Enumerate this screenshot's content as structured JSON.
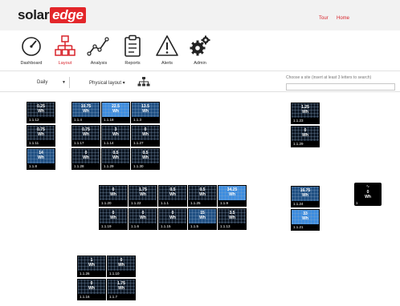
{
  "header": {
    "logo": {
      "solar": "solar",
      "edge": "edge"
    },
    "tour": "Tour",
    "home": "Home"
  },
  "nav": [
    {
      "label": "Dashboard",
      "icon": "dashboard-gauge-icon"
    },
    {
      "label": "Layout",
      "icon": "layout-sitemap-icon",
      "active": true
    },
    {
      "label": "Analysis",
      "icon": "analysis-line-chart-icon"
    },
    {
      "label": "Reports",
      "icon": "reports-clipboard-icon"
    },
    {
      "label": "Alerts",
      "icon": "alerts-warning-icon"
    },
    {
      "label": "Admin",
      "icon": "admin-gears-icon"
    }
  ],
  "site": {
    "choose": "Choose a site (insert at least 3 letters to search)",
    "value": ""
  },
  "toolbar": {
    "period": "Daily",
    "layout": "Physical layout ▾"
  },
  "colors": {
    "brand_red": "#d8232a",
    "tile_dark": "#0d1622",
    "tile_mid": "#1f4f82",
    "tile_bright": "#3d8de0"
  },
  "groups": [
    {
      "name": "group-a",
      "tiles": [
        {
          "value": "0.25",
          "unit": "Wh",
          "id": "1.1.12",
          "level": "dark"
        },
        {
          "value": "10.75",
          "unit": "Wh",
          "id": "1.1.4",
          "level": "mid"
        },
        {
          "value": "22.5",
          "unit": "Wh",
          "id": "1.1.18",
          "level": "bright"
        },
        {
          "value": "13.5",
          "unit": "Wh",
          "id": "1.1.3",
          "level": "mid"
        },
        {
          "value": "0.75",
          "unit": "Wh",
          "id": "1.1.11",
          "level": "dark"
        },
        {
          "value": "0.75",
          "unit": "Wh",
          "id": "1.1.17",
          "level": "dark"
        },
        {
          "value": "3",
          "unit": "Wh",
          "id": "1.1.14",
          "level": "dark"
        },
        {
          "value": "0",
          "unit": "Wh",
          "id": "1.1.27",
          "level": "dark"
        },
        {
          "value": "14",
          "unit": "Wh",
          "id": "1.1.8",
          "level": "mid"
        },
        {
          "value": "0",
          "unit": "Wh",
          "id": "1.1.28",
          "level": "dark"
        },
        {
          "value": "0.5",
          "unit": "Wh",
          "id": "1.1.29",
          "level": "dark"
        },
        {
          "value": "0.5",
          "unit": "Wh",
          "id": "1.1.30",
          "level": "dark"
        }
      ]
    },
    {
      "name": "group-b",
      "tiles": [
        {
          "value": "0",
          "unit": "Wh",
          "id": "1.1.20",
          "level": "dark"
        },
        {
          "value": "1.75",
          "unit": "Wh",
          "id": "1.1.22",
          "level": "dark"
        },
        {
          "value": "0.5",
          "unit": "Wh",
          "id": "1.1.1",
          "level": "dark"
        },
        {
          "value": "0.5",
          "unit": "Wh",
          "id": "1.1.25",
          "level": "dark"
        },
        {
          "value": "34.25",
          "unit": "Wh",
          "id": "1.1.9",
          "level": "bright"
        },
        {
          "value": "0",
          "unit": "Wh",
          "id": "1.1.19",
          "level": "dark"
        },
        {
          "value": "0",
          "unit": "Wh",
          "id": "1.1.6",
          "level": "dark"
        },
        {
          "value": "0",
          "unit": "Wh",
          "id": "1.1.15",
          "level": "dark"
        },
        {
          "value": "15",
          "unit": "Wh",
          "id": "1.1.5",
          "level": "mid"
        },
        {
          "value": "3.5",
          "unit": "Wh",
          "id": "1.1.13",
          "level": "dark"
        }
      ]
    },
    {
      "name": "group-c",
      "tiles": [
        {
          "value": "1",
          "unit": "Wh",
          "id": "1.1.26",
          "level": "dark"
        },
        {
          "value": "0",
          "unit": "Wh",
          "id": "1.1.10",
          "level": "dark"
        },
        {
          "value": "0",
          "unit": "Wh",
          "id": "1.1.16",
          "level": "dark"
        },
        {
          "value": "1.75",
          "unit": "Wh",
          "id": "1.1.7",
          "level": "dark"
        }
      ]
    },
    {
      "name": "group-d",
      "tiles": [
        {
          "value": "1.25",
          "unit": "Wh",
          "id": "1.1.23",
          "level": "dark"
        },
        {
          "value": "0",
          "unit": "Wh",
          "id": "1.1.29",
          "level": "dark"
        }
      ]
    },
    {
      "name": "group-e",
      "tiles": [
        {
          "value": "16.75",
          "unit": "Wh",
          "id": "1.1.24",
          "level": "mid"
        },
        {
          "value": "33",
          "unit": "Wh",
          "id": "1.1.21",
          "level": "bright"
        }
      ]
    }
  ],
  "inverter": {
    "value": "0",
    "unit": "Wh",
    "id": "1",
    "icon": "inverter-wave-icon"
  }
}
